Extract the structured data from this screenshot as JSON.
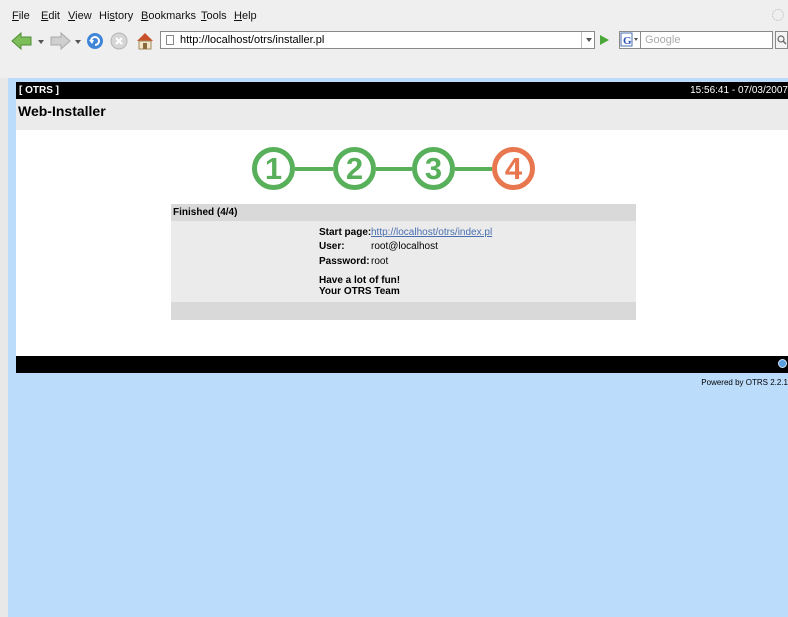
{
  "browser": {
    "menu": [
      "File",
      "Edit",
      "View",
      "History",
      "Bookmarks",
      "Tools",
      "Help"
    ],
    "url": "http://localhost/otrs/installer.pl",
    "search_placeholder": "Google"
  },
  "header": {
    "app_label": "[ OTRS ]",
    "datetime": "15:56:41 - 07/03/2007",
    "page_title": "Web-Installer"
  },
  "steps": [
    "1",
    "2",
    "3",
    "4"
  ],
  "colors": {
    "done": "#58b05a",
    "current": "#e8774f",
    "page_bg": "#bcdcfc"
  },
  "panel": {
    "title": "Finished (4/4)",
    "start_page_label": "Start page:",
    "start_page_value": "http://localhost/otrs/index.pl",
    "user_label": "User:",
    "user_value": "root@localhost",
    "password_label": "Password:",
    "password_value": "root",
    "message_line1": "Have a lot of fun!",
    "message_line2": "Your OTRS Team"
  },
  "footer": {
    "powered_by": "Powered by OTRS 2.2.1"
  }
}
